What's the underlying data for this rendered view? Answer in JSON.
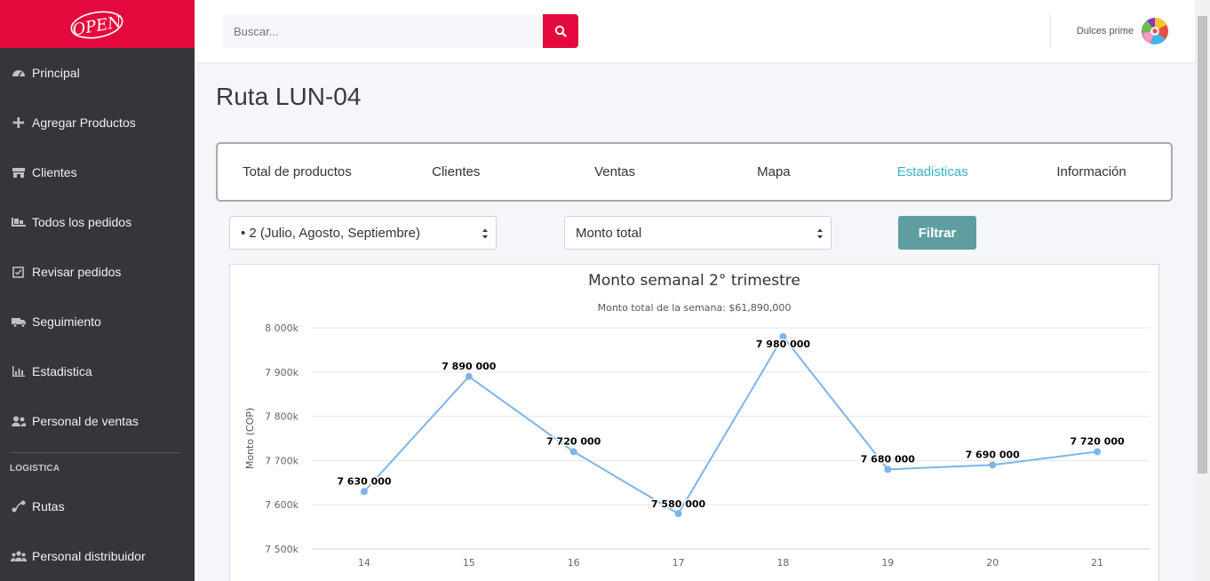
{
  "brand": {
    "logo_text": "OPEN",
    "color": "#e4093d"
  },
  "sidebar": {
    "items": [
      {
        "label": "Principal",
        "icon": "gauge-icon"
      },
      {
        "label": "Agregar Productos",
        "icon": "plus-icon"
      },
      {
        "label": "Clientes",
        "icon": "store-icon"
      },
      {
        "label": "Todos los pedidos",
        "icon": "pallet-icon"
      },
      {
        "label": "Revisar pedidos",
        "icon": "check-square-icon"
      },
      {
        "label": "Seguimiento",
        "icon": "truck-icon"
      },
      {
        "label": "Estadistica",
        "icon": "bar-chart-icon"
      },
      {
        "label": "Personal de ventas",
        "icon": "users-icon"
      }
    ],
    "section_label": "LOGISTICA",
    "logistics_items": [
      {
        "label": "Rutas",
        "icon": "route-icon"
      },
      {
        "label": "Personal distribuidor",
        "icon": "users-group-icon"
      }
    ]
  },
  "header": {
    "search_placeholder": "Buscar...",
    "user_name": "Dulces prime"
  },
  "page": {
    "title": "Ruta LUN-04",
    "tabs": [
      "Total de productos",
      "Clientes",
      "Ventas",
      "Mapa",
      "Estadisticas",
      "Información"
    ],
    "active_tab": "Estadisticas",
    "period_select": "• 2 (Julio, Agosto, Septiembre)",
    "metric_select": "Monto total",
    "filter_label": "Filtrar"
  },
  "chart_data": {
    "type": "line",
    "title": "Monto semanal 2° trimestre",
    "subtitle": "Monto total de la semana: $61,890,000",
    "ylabel": "Monto (COP)",
    "xlabel": "",
    "categories": [
      "14",
      "15",
      "16",
      "17",
      "18",
      "19",
      "20",
      "21"
    ],
    "series": [
      {
        "values": [
          7630000,
          7890000,
          7720000,
          7580000,
          7980000,
          7680000,
          7690000,
          7720000
        ],
        "labels": [
          "7 630 000",
          "7 890 000",
          "7 720 000",
          "7 580 000",
          "7 980 000",
          "7 680 000",
          "7 690 000",
          "7 720 000"
        ],
        "color": "#7cb5ec"
      }
    ],
    "ylim": [
      7500000,
      8000000
    ],
    "yticks": [
      7500000,
      7600000,
      7700000,
      7800000,
      7900000,
      8000000
    ],
    "ytick_labels": [
      "7 500k",
      "7 600k",
      "7 700k",
      "7 800k",
      "7 900k",
      "8 000k"
    ],
    "grid": true
  }
}
